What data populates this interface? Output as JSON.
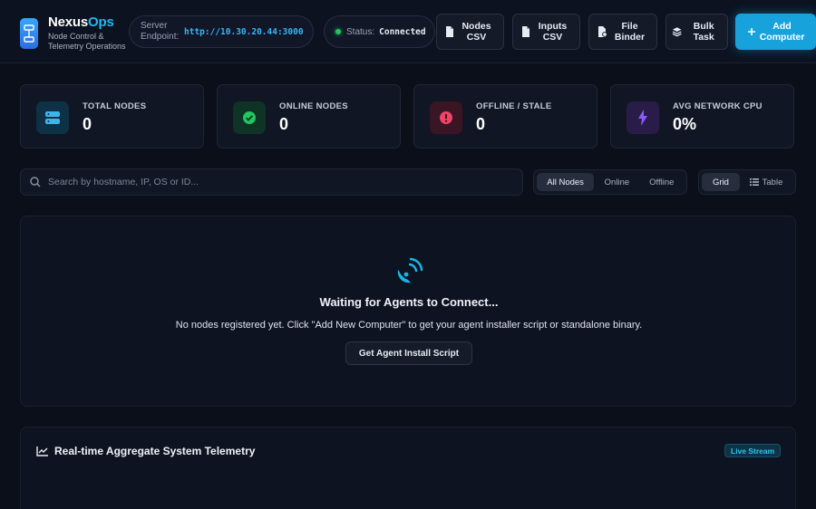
{
  "brand": {
    "name_main": "Nexus",
    "name_accent": "Ops",
    "subtitle": "Node Control & Telemetry Operations"
  },
  "endpoint": {
    "label": "Server Endpoint:",
    "value": "http://10.30.20.44:3000"
  },
  "status": {
    "label": "Status:",
    "value": "Connected",
    "color": "#22c55e"
  },
  "actions": [
    {
      "label": "Nodes CSV",
      "icon": "file-csv-icon"
    },
    {
      "label": "Inputs CSV",
      "icon": "file-csv-icon"
    },
    {
      "label": "File Binder",
      "icon": "file-binder-icon"
    },
    {
      "label": "Bulk Task",
      "icon": "layers-icon"
    },
    {
      "label": "Add Computer",
      "icon": "plus-icon"
    }
  ],
  "stats": [
    {
      "title": "TOTAL NODES",
      "value": "0",
      "icon": "server-icon",
      "color": "#3fb4ea"
    },
    {
      "title": "ONLINE NODES",
      "value": "0",
      "icon": "check-circle-icon",
      "color": "#22c55e"
    },
    {
      "title": "OFFLINE / STALE",
      "value": "0",
      "icon": "alert-circle-icon",
      "color": "#ef4466"
    },
    {
      "title": "AVG NETWORK CPU",
      "value": "0%",
      "icon": "bolt-icon",
      "color": "#8b5cf6"
    }
  ],
  "search": {
    "placeholder": "Search by hostname, IP, OS or ID..."
  },
  "filters": [
    "All Nodes",
    "Online",
    "Offline"
  ],
  "views": [
    "Grid",
    "Table"
  ],
  "empty_state": {
    "title": "Waiting for Agents to Connect...",
    "description": "No nodes registered yet. Click \"Add New Computer\" to get your agent installer script or standalone binary.",
    "button": "Get Agent Install Script"
  },
  "telemetry": {
    "title": "Real-time Aggregate System Telemetry",
    "badge": "Live Stream"
  }
}
